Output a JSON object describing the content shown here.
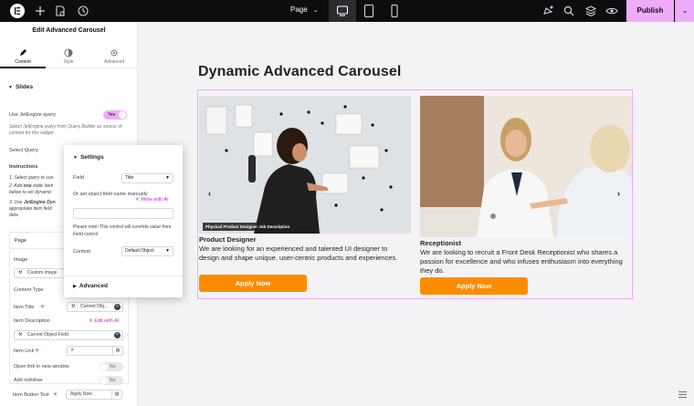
{
  "topbar": {
    "page_label": "Page",
    "publish_label": "Publish"
  },
  "panel": {
    "title": "Edit Advanced Carousel",
    "tabs": [
      {
        "label": "Content",
        "icon": "pencil-icon"
      },
      {
        "label": "Style",
        "icon": "half-circle-icon"
      },
      {
        "label": "Advanced",
        "icon": "gear-icon"
      }
    ],
    "section": "Slides",
    "use_query_label": "Use JetEngine query",
    "use_query_value": "Yes",
    "use_query_help": "Select JetEngine query from Query Builder as source of content for this widget.",
    "select_query_label": "Select Query",
    "instructions_label": "Instructions",
    "instr_1": "1. Select query to use",
    "instr_2a": "2. Add ",
    "instr_2b": "one",
    "instr_2c": " static item",
    "instr_2d": "below to set dynamic",
    "instr_3a": "3. Use ",
    "instr_3b": "JetEngine Dyn",
    "instr_3c": "appropriate item field",
    "instr_3d": "data",
    "repeater": {
      "head": "Page",
      "image_label": "Image",
      "image_value": "Custom Image",
      "content_type_label": "Content Type",
      "item_title_label": "Item Title",
      "item_title_value": "Current Obj...",
      "item_desc_label": "Item Description",
      "write_ai": "Edit with AI",
      "item_desc_value": "Current Object Field",
      "item_link_label": "Item Link",
      "item_link_value": "#",
      "new_window_label": "Open link in new window",
      "nofollow_label": "Add nofollow",
      "toggle_off": "No",
      "button_text_label": "Item Button Text",
      "button_text_value": "Apply Now"
    }
  },
  "popover": {
    "title": "Settings",
    "field_label": "Field",
    "field_value": "Title",
    "or_set": "Or set object field name manually",
    "write_ai": "Write with AI",
    "note": "Please note! This control will override value from Field control",
    "context_label": "Context",
    "context_value": "Default Object",
    "advanced": "Advanced"
  },
  "canvas": {
    "heading": "Dynamic Advanced Carousel",
    "slides": [
      {
        "chip": "Physical Product Designer Job Description",
        "title": "Product Designer",
        "desc": "We are looking for an experienced and talented UI designer to design and shape unique, user-centric products and experiences.",
        "button": "Apply Now"
      },
      {
        "title": "Receptionist",
        "desc": "We are looking to recruit a Front Desk Receptionist who shares a passion for excellence and who infuses enthusiasm into everything they do.",
        "button": "Apply Now"
      }
    ],
    "prev_arrow": "‹",
    "next_arrow": "›"
  },
  "colors": {
    "accent_pink": "#f0abfc",
    "button_orange": "#fb8c00",
    "topbar": "#0c0d0e"
  }
}
